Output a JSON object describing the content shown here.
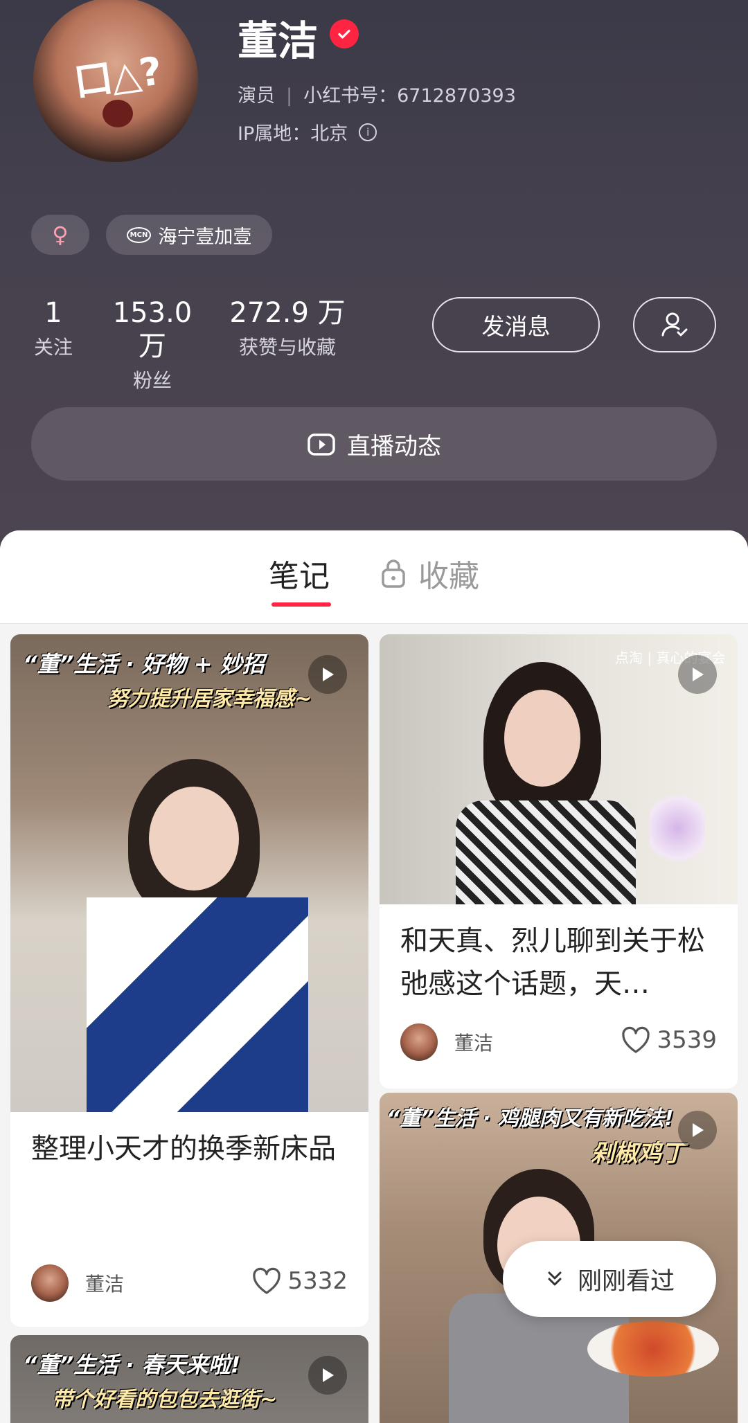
{
  "profile": {
    "name": "董洁",
    "role": "演员",
    "id_label": "小红书号：6712870393",
    "ip_label": "IP属地：北京",
    "gender_symbol": "♀",
    "mcn_badge": "MCN",
    "mcn_label": "海宁壹加壹",
    "avatar_doodle": "口△?"
  },
  "stats": [
    {
      "num": "1",
      "label": "关注"
    },
    {
      "num": "153.0 万",
      "label": "粉丝"
    },
    {
      "num": "272.9 万",
      "label": "获赞与收藏"
    }
  ],
  "actions": {
    "message_label": "发消息",
    "live_label": "直播动态"
  },
  "tabs": {
    "notes": "笔记",
    "collections": "收藏"
  },
  "cards": [
    {
      "title": "整理小天才的换季新床品",
      "author": "董洁",
      "likes": "5332",
      "overlay_line1": "“董”生活 · 好物 + 妙招",
      "overlay_line2": "努力提升居家幸福感~"
    },
    {
      "title": "和天真、烈儿聊到关于松弛感这个话题，天…",
      "author": "董洁",
      "likes": "3539",
      "watermark": "点淘 | 真心的宴会"
    },
    {
      "overlay_line1": "“董”生活 · 鸡腿肉又有新吃法!",
      "overlay_line2": "剁椒鸡丁"
    },
    {
      "overlay_line1": "“董”生活 · 春天来啦!",
      "overlay_line2": "带个好看的包包去逛街~"
    }
  ],
  "recent": {
    "label": "刚刚看过"
  },
  "colors": {
    "accent": "#ff2442",
    "header_bg": "#45404d"
  }
}
